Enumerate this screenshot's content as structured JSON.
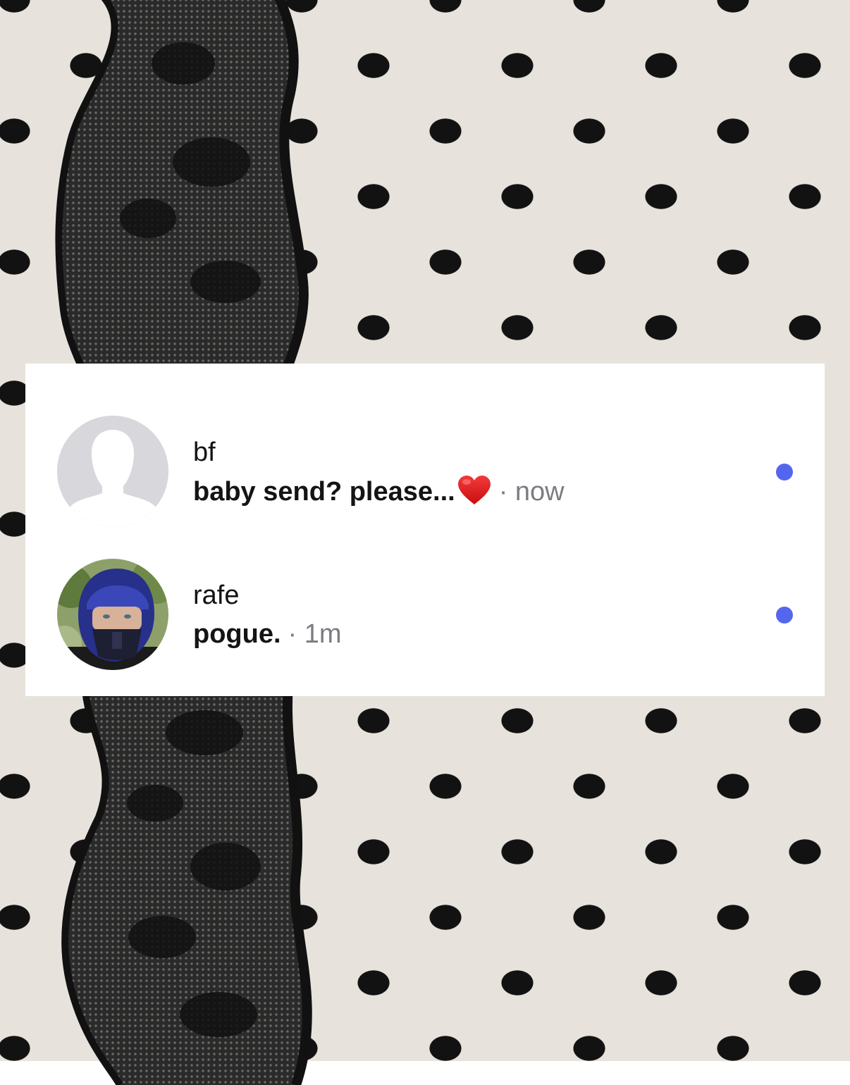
{
  "colors": {
    "background": "#e7e3dc",
    "dots": "#121212",
    "card": "#ffffff",
    "unread_dot": "#5566ee",
    "timestamp": "#7b7b82"
  },
  "conversations": [
    {
      "name": "bf",
      "message": "baby send? please...",
      "emoji": "heart-icon",
      "separator": "·",
      "time": "now",
      "avatar": "default-avatar-icon",
      "unread": true
    },
    {
      "name": "rafe",
      "message": "pogue.",
      "separator": "·",
      "time": "1m",
      "avatar": "helmet-photo",
      "unread": true
    }
  ]
}
